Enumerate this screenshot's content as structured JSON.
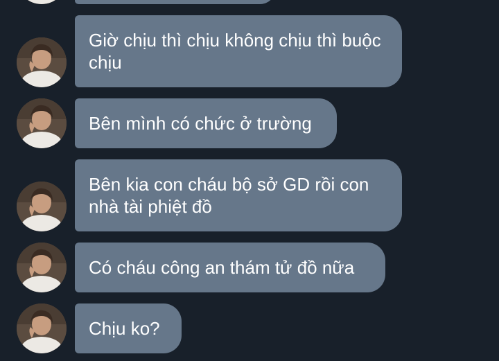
{
  "messages": [
    {
      "text": "Giờ chịu thì chịu không chịu thì buộc chịu"
    },
    {
      "text": "Bên mình có chức ở trường"
    },
    {
      "text": "Bên kia con cháu bộ sở GD rồi con nhà tài phiệt đồ"
    },
    {
      "text": "Có cháu công an thám tử đồ nữa"
    },
    {
      "text": "Chịu ko?"
    }
  ],
  "colors": {
    "background": "#18202a",
    "bubble": "#66778a",
    "text": "#ffffff"
  }
}
